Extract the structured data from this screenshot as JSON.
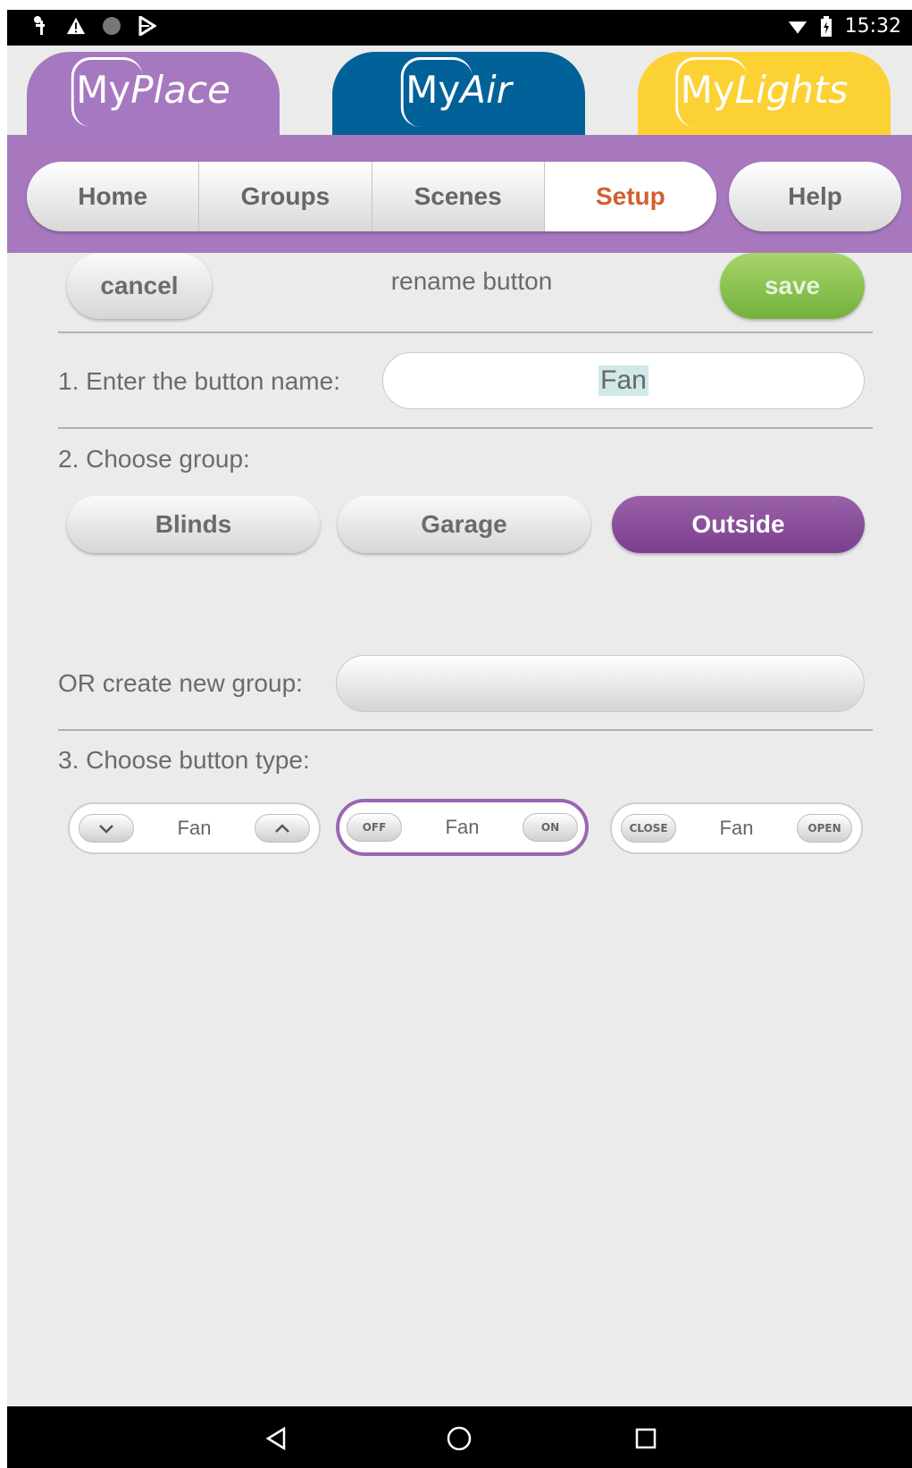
{
  "status_bar": {
    "time": "15:32",
    "left_icons": [
      "usb-icon",
      "warning-icon",
      "dot-icon",
      "play-store-icon"
    ],
    "right_icons": [
      "wifi-icon",
      "battery-icon"
    ]
  },
  "brand_tabs": [
    {
      "my": "My",
      "name": "Place",
      "color": "#a678c0"
    },
    {
      "my": "My",
      "name": "Air",
      "color": "#006298"
    },
    {
      "my": "My",
      "name": "Lights",
      "color": "#fcd134"
    }
  ],
  "nav": {
    "items": [
      "Home",
      "Groups",
      "Scenes",
      "Setup"
    ],
    "active": "Setup",
    "help": "Help"
  },
  "header": {
    "cancel": "cancel",
    "title": "rename button",
    "save": "save"
  },
  "step1": {
    "label": "1. Enter the button name:",
    "value": "Fan"
  },
  "step2": {
    "label": "2. Choose group:",
    "groups": [
      "Blinds",
      "Garage",
      "Outside"
    ],
    "selected": "Outside",
    "new_group_label": "OR create new group:",
    "new_group_value": ""
  },
  "step3": {
    "label": "3. Choose button type:",
    "types": [
      {
        "left": "",
        "left_icon": "chevron-down-icon",
        "center": "Fan",
        "right": "",
        "right_icon": "chevron-up-icon"
      },
      {
        "left": "OFF",
        "center": "Fan",
        "right": "ON"
      },
      {
        "left": "CLOSE",
        "center": "Fan",
        "right": "OPEN"
      }
    ],
    "selected_index": 1
  },
  "colors": {
    "accent_purple": "#a878be",
    "active_tab_text": "#d35f2f",
    "save_green": "#72b13c",
    "selected_group": "#7b3e8e"
  }
}
